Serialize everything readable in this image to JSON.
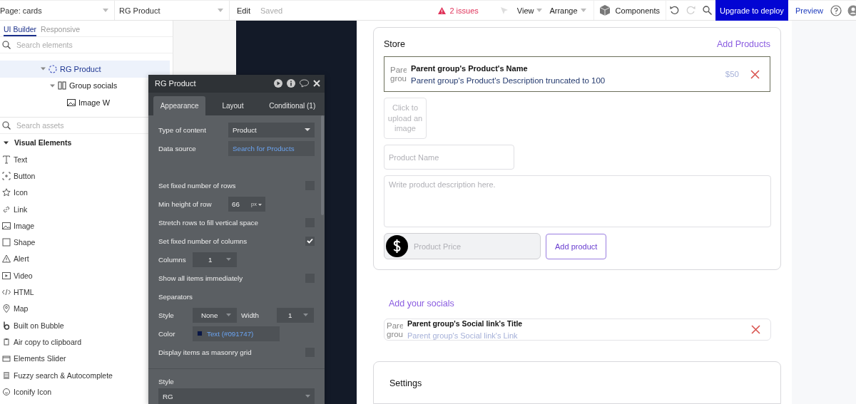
{
  "topbar": {
    "page_select": "Page: cards",
    "element_select": "RG Product",
    "edit": "Edit",
    "save_status": "Saved",
    "issues": "2 issues",
    "menus": [
      "View",
      "Arrange"
    ],
    "components": "Components",
    "redo": {
      "disabled": true
    },
    "upgrade": "Upgrade to deploy",
    "preview": "Preview"
  },
  "left_panel": {
    "tabs": [
      {
        "label": "UI Builder",
        "selected": true
      },
      {
        "label": "Responsive",
        "selected": false
      }
    ],
    "element_search": {
      "placeholder": "Search elements"
    },
    "tree": [
      {
        "label": "RG Product",
        "expanded": true,
        "selected": true,
        "children": [
          {
            "label": "Group socials",
            "expanded": true,
            "selected": false,
            "children": [
              {
                "label": "Image W",
                "selected": false
              }
            ]
          }
        ]
      }
    ],
    "asset_search": {
      "placeholder": "Search assets"
    },
    "section": {
      "label": "Visual Elements",
      "expanded": true
    },
    "assets": [
      "Text",
      "Button",
      "Icon",
      "Link",
      "Image",
      "Shape",
      "Alert",
      "Video",
      "HTML",
      "Map",
      "Built on Bubble",
      "Air copy to clipboard",
      "Elements Slider",
      "Fuzzy search & Autocomplete",
      "Iconify Icon"
    ]
  },
  "properties": {
    "title": "RG Product",
    "tabs": [
      {
        "label": "Appearance",
        "selected": true
      },
      {
        "label": "Layout",
        "selected": false
      },
      {
        "label": "Conditional (1)",
        "selected": false
      }
    ],
    "rows": [
      {
        "kind": "select",
        "label": "Type of content",
        "value": "Product"
      },
      {
        "kind": "dynamic",
        "label": "Data source",
        "value": "Search for Products"
      },
      {
        "kind": "check",
        "label": "Set fixed number of rows",
        "checked": false
      },
      {
        "kind": "number",
        "label": "Min height of row",
        "value": "66",
        "unit": "px"
      },
      {
        "kind": "check",
        "label": "Stretch rows to fill vertical space",
        "checked": false
      },
      {
        "kind": "check",
        "label": "Set fixed number of columns",
        "checked": true
      },
      {
        "kind": "small-select",
        "label": "Columns",
        "value": "1"
      },
      {
        "kind": "check",
        "label": "Show all items immediately",
        "checked": false
      },
      {
        "kind": "heading",
        "label": "Separators"
      },
      {
        "kind": "pair",
        "label": "Style",
        "value": "None",
        "label2": "Width",
        "value2": "1"
      },
      {
        "kind": "color",
        "label": "Color",
        "value": "Text (#091747)",
        "color": "#091747"
      },
      {
        "kind": "check",
        "label": "Display items as masonry grid",
        "checked": false
      },
      {
        "kind": "section",
        "label": "Style"
      },
      {
        "kind": "wide-select",
        "value": "RG"
      }
    ]
  },
  "store": {
    "title": "Store",
    "add_link": "Add Products",
    "product": {
      "image_alt": [
        "Pare",
        "grou"
      ],
      "name": "Parent group's Product's Name",
      "description": "Parent group's Product's Description truncated to 100",
      "price": "$50"
    },
    "upload": "Click to upload an image",
    "name_field": {
      "placeholder": "Product Name"
    },
    "description_field": {
      "placeholder": "Write product description here."
    },
    "price_field": {
      "placeholder": "Product Price"
    },
    "add_button": "Add product"
  },
  "socials": {
    "title": "Add your socials",
    "item": {
      "image_alt": [
        "Pare",
        "grou"
      ],
      "title": "Parent group's Social link's Title",
      "link": "Parent group's Social link's Link"
    }
  },
  "settings": {
    "title": "Settings"
  }
}
